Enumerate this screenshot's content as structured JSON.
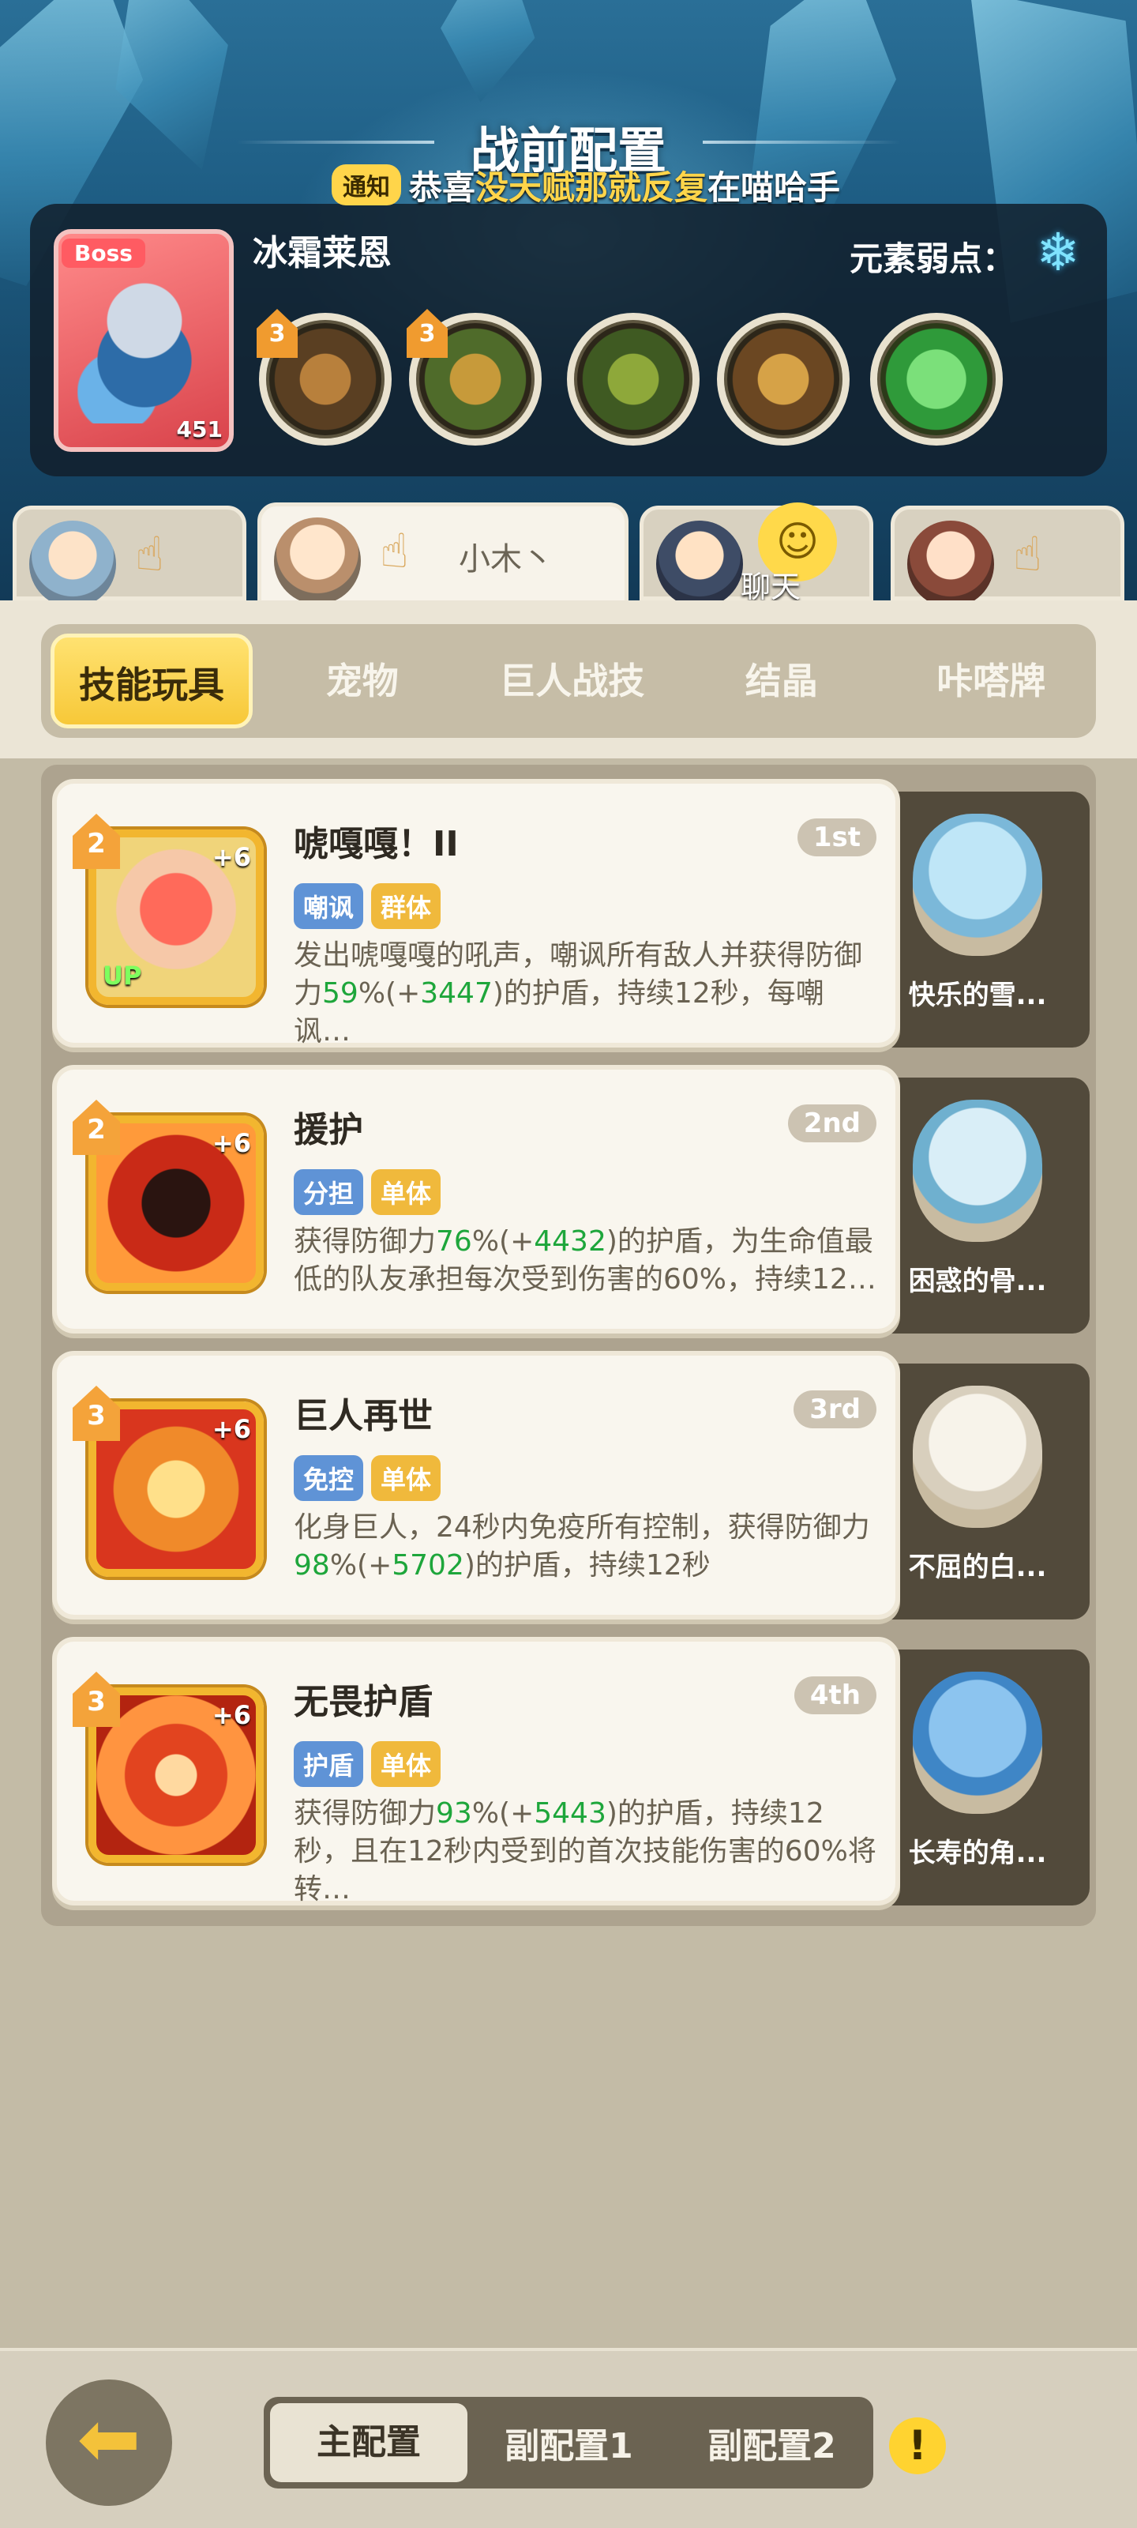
{
  "page_title": "战前配置",
  "boss": {
    "tag": "Boss",
    "level": "451",
    "name": "冰霜莱恩",
    "weakness_label": "元素弱点：",
    "weakness_icon": "snowflake-icon",
    "skill_levels": [
      "3",
      "3"
    ]
  },
  "notice": {
    "badge": "通知",
    "text_prefix": "恭喜",
    "text_highlight": "没天赋那就反复",
    "text_suffix": "在喵哈手"
  },
  "members": [
    {
      "name": ""
    },
    {
      "name": "小木丶"
    },
    {
      "name": ""
    },
    {
      "name": ""
    }
  ],
  "chat_label": "聊天",
  "categories": [
    "技能玩具",
    "宠物",
    "巨人战技",
    "结晶",
    "咔嗒牌"
  ],
  "skills": [
    {
      "title": "唬嘎嘎！II",
      "rank": "1st",
      "level": "2",
      "plus": "+6",
      "up": "UP",
      "tags": [
        "嘲讽",
        "群体"
      ],
      "desc_a": "发出唬嘎嘎的吼声，嘲讽所有敌人并获得防御力",
      "desc_g1": "59",
      "desc_b": "%(+",
      "desc_g2": "3447",
      "desc_c": ")的护盾，持续12秒，每嘲讽…",
      "pet": "快乐的雪..."
    },
    {
      "title": "援护",
      "rank": "2nd",
      "level": "2",
      "plus": "+6",
      "up": "",
      "tags": [
        "分担",
        "单体"
      ],
      "desc_a": "获得防御力",
      "desc_g1": "76",
      "desc_b": "%(+",
      "desc_g2": "4432",
      "desc_c": ")的护盾，为生命值最低的队友承担每次受到伤害的60%，持续12…",
      "pet": "困惑的骨..."
    },
    {
      "title": "巨人再世",
      "rank": "3rd",
      "level": "3",
      "plus": "+6",
      "up": "",
      "tags": [
        "免控",
        "单体"
      ],
      "desc_a": "化身巨人，24秒内免疫所有控制，获得防御力",
      "desc_g1": "98",
      "desc_b": "%(+",
      "desc_g2": "5702",
      "desc_c": ")的护盾，持续12秒",
      "pet": "不屈的白..."
    },
    {
      "title": "无畏护盾",
      "rank": "4th",
      "level": "3",
      "plus": "+6",
      "up": "",
      "tags": [
        "护盾",
        "单体"
      ],
      "desc_a": "获得防御力",
      "desc_g1": "93",
      "desc_b": "%(+",
      "desc_g2": "5443",
      "desc_c": ")的护盾，持续12秒，且在12秒内受到的首次技能伤害的60%将转…",
      "pet": "长寿的角..."
    }
  ],
  "footer": {
    "configs": [
      "主配置",
      "副配置1",
      "副配置2"
    ],
    "warn": "!"
  }
}
